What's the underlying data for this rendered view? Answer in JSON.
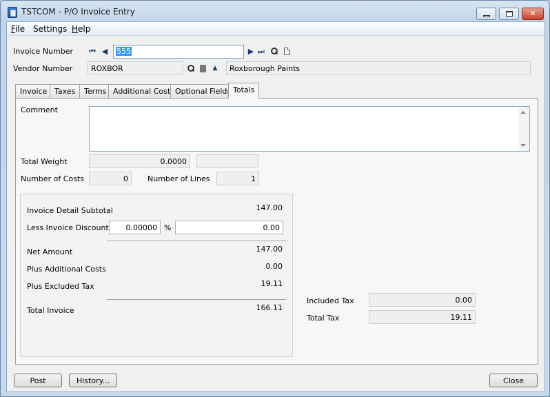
{
  "window": {
    "title": "TSTCOM - P/O Invoice Entry"
  },
  "menu": {
    "file": {
      "mnemonic": "F",
      "rest": "ile"
    },
    "settings": {
      "label": "Settings"
    },
    "help": {
      "mnemonic": "H",
      "rest": "elp"
    }
  },
  "header": {
    "invoice_number_label": "Invoice Number",
    "invoice_number_value": "555",
    "vendor_number_label": "Vendor Number",
    "vendor_number_value": "ROXBOR",
    "vendor_name": "Roxborough Paints"
  },
  "tabs": [
    {
      "label": "Invoice"
    },
    {
      "label": "Taxes"
    },
    {
      "label": "Terms"
    },
    {
      "label": "Additional Costs"
    },
    {
      "label": "Optional Fields"
    },
    {
      "label": "Totals",
      "active": true
    }
  ],
  "totals": {
    "comment_label": "Comment",
    "comment_value": "",
    "total_weight_label": "Total Weight",
    "total_weight_value": "0.0000",
    "total_weight_unit": "",
    "number_of_costs_label": "Number of Costs",
    "number_of_costs_value": "0",
    "number_of_lines_label": "Number of Lines",
    "number_of_lines_value": "1",
    "invoice_detail_subtotal_label": "Invoice Detail Subtotal",
    "invoice_detail_subtotal_value": "147.00",
    "less_invoice_discount_label": "Less Invoice Discount",
    "discount_percent_value": "0.00000",
    "percent_symbol": "%",
    "discount_amount_value": "0.00",
    "net_amount_label": "Net Amount",
    "net_amount_value": "147.00",
    "plus_additional_costs_label": "Plus Additional Costs",
    "plus_additional_costs_value": "0.00",
    "plus_excluded_tax_label": "Plus Excluded Tax",
    "plus_excluded_tax_value": "19.11",
    "total_invoice_label": "Total Invoice",
    "total_invoice_value": "166.11",
    "included_tax_label": "Included Tax",
    "included_tax_value": "0.00",
    "total_tax_label": "Total Tax",
    "total_tax_value": "19.11"
  },
  "buttons": {
    "post": "Post",
    "history": "History...",
    "close": "Close"
  },
  "icons": {
    "nav_first": "first-record-icon",
    "nav_prev": "previous-record-icon",
    "nav_next": "next-record-icon",
    "nav_last": "last-record-icon",
    "finder": "search-icon",
    "new": "new-document-icon",
    "zoom": "zoom-icon"
  }
}
